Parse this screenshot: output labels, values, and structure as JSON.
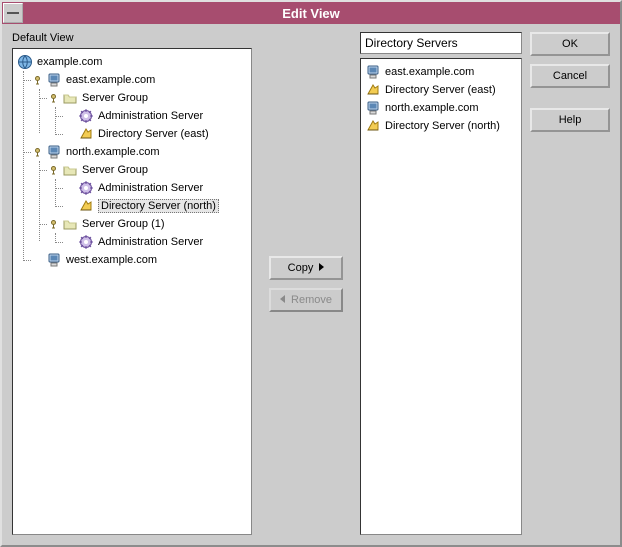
{
  "window": {
    "title": "Edit View"
  },
  "leftLabel": "Default View",
  "rightInput": "Directory Servers",
  "buttons": {
    "copy": "Copy",
    "remove": "Remove",
    "ok": "OK",
    "cancel": "Cancel",
    "help": "Help"
  },
  "root": {
    "label": "example.com",
    "children": [
      {
        "label": "east.example.com",
        "icon": "host",
        "children": [
          {
            "label": "Server Group",
            "icon": "folder",
            "children": [
              {
                "label": "Administration Server",
                "icon": "proc"
              },
              {
                "label": "Directory Server (east)",
                "icon": "dir"
              }
            ]
          }
        ]
      },
      {
        "label": "north.example.com",
        "icon": "host",
        "children": [
          {
            "label": "Server Group",
            "icon": "folder",
            "children": [
              {
                "label": "Administration Server",
                "icon": "proc"
              },
              {
                "label": "Directory Server (north)",
                "icon": "dir",
                "selected": true
              }
            ]
          },
          {
            "label": "Server Group (1)",
            "icon": "folder",
            "children": [
              {
                "label": "Administration Server",
                "icon": "proc"
              }
            ]
          }
        ]
      },
      {
        "label": "west.example.com",
        "icon": "host"
      }
    ]
  },
  "rightList": [
    {
      "label": "east.example.com",
      "icon": "host"
    },
    {
      "label": "Directory Server (east)",
      "icon": "dir"
    },
    {
      "label": "north.example.com",
      "icon": "host"
    },
    {
      "label": "Directory Server (north)",
      "icon": "dir"
    }
  ]
}
